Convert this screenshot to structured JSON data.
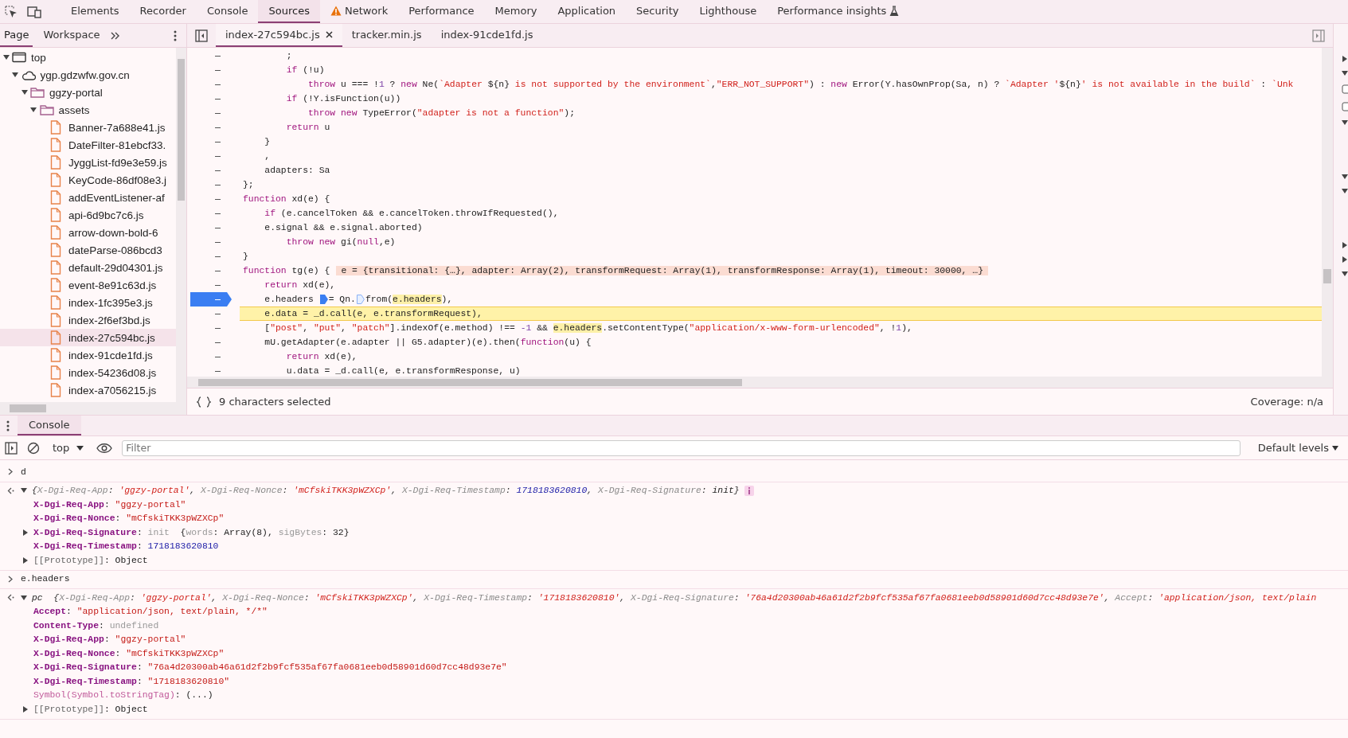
{
  "main_tabs": [
    {
      "label": "Elements",
      "selected": false,
      "kind": "plain"
    },
    {
      "label": "Recorder",
      "selected": false,
      "kind": "plain"
    },
    {
      "label": "Console",
      "selected": false,
      "kind": "plain"
    },
    {
      "label": "Sources",
      "selected": true,
      "kind": "plain"
    },
    {
      "label": "Network",
      "selected": false,
      "kind": "warning"
    },
    {
      "label": "Performance",
      "selected": false,
      "kind": "plain"
    },
    {
      "label": "Memory",
      "selected": false,
      "kind": "plain"
    },
    {
      "label": "Application",
      "selected": false,
      "kind": "plain"
    },
    {
      "label": "Security",
      "selected": false,
      "kind": "plain"
    },
    {
      "label": "Lighthouse",
      "selected": false,
      "kind": "plain"
    },
    {
      "label": "Performance insights",
      "selected": false,
      "kind": "experimental"
    }
  ],
  "navigator": {
    "tabs": [
      {
        "label": "Page",
        "selected": true
      },
      {
        "label": "Workspace",
        "selected": false
      }
    ],
    "tree": [
      {
        "label": "top",
        "kind": "frame",
        "expanded": true,
        "selected": false,
        "children": [
          {
            "label": "ygp.gdzwfw.gov.cn",
            "kind": "domain",
            "expanded": true,
            "selected": false,
            "children": [
              {
                "label": "ggzy-portal",
                "kind": "folder",
                "expanded": true,
                "selected": false,
                "children": [
                  {
                    "label": "assets",
                    "kind": "folder",
                    "expanded": true,
                    "selected": false,
                    "children": [
                      {
                        "label": "Banner-7a688e41.js",
                        "kind": "file",
                        "selected": false
                      },
                      {
                        "label": "DateFilter-81ebcf33.",
                        "kind": "file",
                        "selected": false
                      },
                      {
                        "label": "JyggList-fd9e3e59.js",
                        "kind": "file",
                        "selected": false
                      },
                      {
                        "label": "KeyCode-86df08e3.j",
                        "kind": "file",
                        "selected": false
                      },
                      {
                        "label": "addEventListener-af",
                        "kind": "file",
                        "selected": false
                      },
                      {
                        "label": "api-6d9bc7c6.js",
                        "kind": "file",
                        "selected": false
                      },
                      {
                        "label": "arrow-down-bold-6",
                        "kind": "file",
                        "selected": false
                      },
                      {
                        "label": "dateParse-086bcd3",
                        "kind": "file",
                        "selected": false
                      },
                      {
                        "label": "default-29d04301.js",
                        "kind": "file",
                        "selected": false
                      },
                      {
                        "label": "event-8e91c63d.js",
                        "kind": "file",
                        "selected": false
                      },
                      {
                        "label": "index-1fc395e3.js",
                        "kind": "file",
                        "selected": false
                      },
                      {
                        "label": "index-2f6ef3bd.js",
                        "kind": "file",
                        "selected": false
                      },
                      {
                        "label": "index-27c594bc.js",
                        "kind": "file",
                        "selected": true
                      },
                      {
                        "label": "index-91cde1fd.js",
                        "kind": "file",
                        "selected": false
                      },
                      {
                        "label": "index-54236d08.js",
                        "kind": "file",
                        "selected": false
                      },
                      {
                        "label": "index-a7056215.js",
                        "kind": "file",
                        "selected": false
                      }
                    ]
                  }
                ]
              }
            ]
          }
        ]
      }
    ]
  },
  "editor": {
    "tabs": [
      {
        "label": "index-27c594bc.js",
        "selected": true
      },
      {
        "label": "tracker.min.js",
        "selected": false
      },
      {
        "label": "index-91cde1fd.js",
        "selected": false
      }
    ],
    "lines": [
      {
        "breakpoint": false,
        "paused": false,
        "tokens": [
          {
            "kind": "plain",
            "text": "        ;"
          }
        ]
      },
      {
        "breakpoint": false,
        "paused": false,
        "tokens": [
          {
            "kind": "keyword",
            "text": "        if"
          },
          {
            "kind": "plain",
            "text": " (!u)"
          }
        ]
      },
      {
        "breakpoint": false,
        "paused": false,
        "tokens": [
          {
            "kind": "keyword",
            "text": "            throw"
          },
          {
            "kind": "plain",
            "text": " u === !"
          },
          {
            "kind": "number",
            "text": "1"
          },
          {
            "kind": "plain",
            "text": " ? "
          },
          {
            "kind": "keyword",
            "text": "new"
          },
          {
            "kind": "plain",
            "text": " Ne("
          },
          {
            "kind": "string",
            "text": "`Adapter "
          },
          {
            "kind": "plain",
            "text": "${n}"
          },
          {
            "kind": "string",
            "text": " is not supported by the environment`"
          },
          {
            "kind": "plain",
            "text": ","
          },
          {
            "kind": "string",
            "text": "\"ERR_NOT_SUPPORT\""
          },
          {
            "kind": "plain",
            "text": ") : "
          },
          {
            "kind": "keyword",
            "text": "new"
          },
          {
            "kind": "plain",
            "text": " Error(Y.hasOwnProp(Sa, n) ? "
          },
          {
            "kind": "string",
            "text": "`Adapter '"
          },
          {
            "kind": "plain",
            "text": "${n}"
          },
          {
            "kind": "string",
            "text": "' is not available in the build`"
          },
          {
            "kind": "plain",
            "text": " : "
          },
          {
            "kind": "string",
            "text": "`Unk"
          }
        ]
      },
      {
        "breakpoint": false,
        "paused": false,
        "tokens": [
          {
            "kind": "keyword",
            "text": "        if"
          },
          {
            "kind": "plain",
            "text": " (!Y.isFunction(u))"
          }
        ]
      },
      {
        "breakpoint": false,
        "paused": false,
        "tokens": [
          {
            "kind": "keyword",
            "text": "            throw new"
          },
          {
            "kind": "plain",
            "text": " TypeError("
          },
          {
            "kind": "string",
            "text": "\"adapter is not a function\""
          },
          {
            "kind": "plain",
            "text": ");"
          }
        ]
      },
      {
        "breakpoint": false,
        "paused": false,
        "tokens": [
          {
            "kind": "keyword",
            "text": "        return"
          },
          {
            "kind": "plain",
            "text": " u"
          }
        ]
      },
      {
        "breakpoint": false,
        "paused": false,
        "tokens": [
          {
            "kind": "plain",
            "text": "    }"
          }
        ]
      },
      {
        "breakpoint": false,
        "paused": false,
        "tokens": [
          {
            "kind": "plain",
            "text": "    ,"
          }
        ]
      },
      {
        "breakpoint": false,
        "paused": false,
        "tokens": [
          {
            "kind": "plain",
            "text": "    adapters: Sa"
          }
        ]
      },
      {
        "breakpoint": false,
        "paused": false,
        "tokens": [
          {
            "kind": "plain",
            "text": "};"
          }
        ]
      },
      {
        "breakpoint": false,
        "paused": false,
        "tokens": [
          {
            "kind": "keyword",
            "text": "function"
          },
          {
            "kind": "plain",
            "text": " xd(e) {"
          }
        ]
      },
      {
        "breakpoint": false,
        "paused": false,
        "tokens": [
          {
            "kind": "keyword",
            "text": "    if"
          },
          {
            "kind": "plain",
            "text": " (e.cancelToken && e.cancelToken.throwIfRequested(),"
          }
        ]
      },
      {
        "breakpoint": false,
        "paused": false,
        "tokens": [
          {
            "kind": "plain",
            "text": "    e.signal && e.signal.aborted)"
          }
        ]
      },
      {
        "breakpoint": false,
        "paused": false,
        "tokens": [
          {
            "kind": "keyword",
            "text": "        throw new"
          },
          {
            "kind": "plain",
            "text": " gi("
          },
          {
            "kind": "keyword",
            "text": "null"
          },
          {
            "kind": "plain",
            "text": ",e)"
          }
        ]
      },
      {
        "breakpoint": false,
        "paused": false,
        "tokens": [
          {
            "kind": "plain",
            "text": "}"
          }
        ]
      },
      {
        "breakpoint": false,
        "paused": false,
        "tokens": [
          {
            "kind": "keyword",
            "text": "function"
          },
          {
            "kind": "plain",
            "text": " tg(e) {"
          },
          {
            "kind": "inline_value",
            "text": "e = {transitional: {…}, adapter: Array(2), transformRequest: Array(1), transformResponse: Array(1), timeout: 30000, …}"
          }
        ]
      },
      {
        "breakpoint": false,
        "paused": false,
        "tokens": [
          {
            "kind": "keyword",
            "text": "    return"
          },
          {
            "kind": "plain",
            "text": " xd(e),"
          }
        ]
      },
      {
        "breakpoint": true,
        "paused": false,
        "tokens": [
          {
            "kind": "plain",
            "text": "    e.headers "
          },
          {
            "kind": "inline_breakpoint",
            "active": true
          },
          {
            "kind": "plain",
            "text": "= Qn."
          },
          {
            "kind": "inline_breakpoint",
            "active": false
          },
          {
            "kind": "plain",
            "text": "from("
          },
          {
            "kind": "match",
            "text": "e.headers"
          },
          {
            "kind": "plain",
            "text": "),"
          }
        ]
      },
      {
        "breakpoint": false,
        "paused": true,
        "tokens": [
          {
            "kind": "plain",
            "text": "    e.data "
          },
          {
            "kind": "match",
            "text": "="
          },
          {
            "kind": "plain",
            "text": " _d.call(e, e.transformRequest),"
          }
        ]
      },
      {
        "breakpoint": false,
        "paused": false,
        "tokens": [
          {
            "kind": "plain",
            "text": "    ["
          },
          {
            "kind": "string",
            "text": "\"post\""
          },
          {
            "kind": "plain",
            "text": ", "
          },
          {
            "kind": "string",
            "text": "\"put\""
          },
          {
            "kind": "plain",
            "text": ", "
          },
          {
            "kind": "string",
            "text": "\"patch\""
          },
          {
            "kind": "plain",
            "text": "].indexOf(e.method) !== "
          },
          {
            "kind": "number",
            "text": "-1"
          },
          {
            "kind": "plain",
            "text": " && "
          },
          {
            "kind": "match",
            "text": "e.headers"
          },
          {
            "kind": "plain",
            "text": ".setContentType("
          },
          {
            "kind": "string",
            "text": "\"application/x-www-form-urlencoded\""
          },
          {
            "kind": "plain",
            "text": ", !"
          },
          {
            "kind": "number",
            "text": "1"
          },
          {
            "kind": "plain",
            "text": "),"
          }
        ]
      },
      {
        "breakpoint": false,
        "paused": false,
        "tokens": [
          {
            "kind": "plain",
            "text": "    mU.getAdapter(e.adapter || G5.adapter)(e).then("
          },
          {
            "kind": "keyword",
            "text": "function"
          },
          {
            "kind": "plain",
            "text": "(u) {"
          }
        ]
      },
      {
        "breakpoint": false,
        "paused": false,
        "tokens": [
          {
            "kind": "keyword",
            "text": "        return"
          },
          {
            "kind": "plain",
            "text": " xd(e),"
          }
        ]
      },
      {
        "breakpoint": false,
        "paused": false,
        "tokens": [
          {
            "kind": "plain",
            "text": "        u.data = _d.call(e, e.transformResponse, u)"
          }
        ]
      }
    ],
    "status": {
      "selection": "9 characters selected",
      "coverage": "Coverage: n/a"
    }
  },
  "drawer": {
    "tabs": [
      {
        "label": "Console",
        "selected": true
      }
    ],
    "context": "top",
    "filter": {
      "placeholder": "Filter"
    },
    "levels": "Default levels",
    "entries": [
      {
        "kind": "input",
        "text": "d"
      },
      {
        "kind": "result",
        "expanded": true,
        "info_badge": true,
        "preview": [
          {
            "kind": "punct",
            "text": "{"
          },
          {
            "kind": "key",
            "text": "X-Dgi-Req-App"
          },
          {
            "kind": "punct",
            "text": ": "
          },
          {
            "kind": "string",
            "text": "'ggzy-portal'"
          },
          {
            "kind": "punct",
            "text": ", "
          },
          {
            "kind": "key",
            "text": "X-Dgi-Req-Nonce"
          },
          {
            "kind": "punct",
            "text": ": "
          },
          {
            "kind": "string",
            "text": "'mCfskiTKK3pWZXCp'"
          },
          {
            "kind": "punct",
            "text": ", "
          },
          {
            "kind": "key",
            "text": "X-Dgi-Req-Timestamp"
          },
          {
            "kind": "punct",
            "text": ": "
          },
          {
            "kind": "number",
            "text": "1718183620810"
          },
          {
            "kind": "punct",
            "text": ", "
          },
          {
            "kind": "key",
            "text": "X-Dgi-Req-Signature"
          },
          {
            "kind": "punct",
            "text": ": "
          },
          {
            "kind": "plain",
            "text": "init"
          },
          {
            "kind": "punct",
            "text": "}"
          }
        ],
        "properties": [
          {
            "key": "X-Dgi-Req-App",
            "kind": "own",
            "expandable": false,
            "value": [
              {
                "kind": "plain",
                "text": ": "
              },
              {
                "kind": "string",
                "text": "\"ggzy-portal\""
              }
            ]
          },
          {
            "key": "X-Dgi-Req-Nonce",
            "kind": "own",
            "expandable": false,
            "value": [
              {
                "kind": "plain",
                "text": ": "
              },
              {
                "kind": "string",
                "text": "\"mCfskiTKK3pWZXCp\""
              }
            ]
          },
          {
            "key": "X-Dgi-Req-Signature",
            "kind": "own",
            "expandable": true,
            "value": [
              {
                "kind": "plain",
                "text": ": "
              },
              {
                "kind": "muted",
                "text": "init"
              },
              {
                "kind": "plain",
                "text": "  {"
              },
              {
                "kind": "muted",
                "text": "words"
              },
              {
                "kind": "plain",
                "text": ": Array(8), "
              },
              {
                "kind": "muted",
                "text": "sigBytes"
              },
              {
                "kind": "plain",
                "text": ": 32}"
              }
            ]
          },
          {
            "key": "X-Dgi-Req-Timestamp",
            "kind": "own",
            "expandable": false,
            "value": [
              {
                "kind": "plain",
                "text": ": "
              },
              {
                "kind": "number",
                "text": "1718183620810"
              }
            ]
          },
          {
            "key": "[[Prototype]]",
            "kind": "internal",
            "expandable": true,
            "value": [
              {
                "kind": "plain",
                "text": ": Object"
              }
            ]
          }
        ]
      },
      {
        "kind": "input",
        "text": "e.headers"
      },
      {
        "kind": "result",
        "expanded": true,
        "info_badge": false,
        "preview": [
          {
            "kind": "class",
            "text": "pc"
          },
          {
            "kind": "punct",
            "text": "  {"
          },
          {
            "kind": "key",
            "text": "X-Dgi-Req-App"
          },
          {
            "kind": "punct",
            "text": ": "
          },
          {
            "kind": "string",
            "text": "'ggzy-portal'"
          },
          {
            "kind": "punct",
            "text": ", "
          },
          {
            "kind": "key",
            "text": "X-Dgi-Req-Nonce"
          },
          {
            "kind": "punct",
            "text": ": "
          },
          {
            "kind": "string",
            "text": "'mCfskiTKK3pWZXCp'"
          },
          {
            "kind": "punct",
            "text": ", "
          },
          {
            "kind": "key",
            "text": "X-Dgi-Req-Timestamp"
          },
          {
            "kind": "punct",
            "text": ": "
          },
          {
            "kind": "string",
            "text": "'1718183620810'"
          },
          {
            "kind": "punct",
            "text": ", "
          },
          {
            "kind": "key",
            "text": "X-Dgi-Req-Signature"
          },
          {
            "kind": "punct",
            "text": ": "
          },
          {
            "kind": "string",
            "text": "'76a4d20300ab46a61d2f2b9fcf535af67fa0681eeb0d58901d60d7cc48d93e7e'"
          },
          {
            "kind": "punct",
            "text": ", "
          },
          {
            "kind": "key",
            "text": "Accept"
          },
          {
            "kind": "punct",
            "text": ": "
          },
          {
            "kind": "string",
            "text": "'application/json, text/plain"
          }
        ],
        "properties": [
          {
            "key": "Accept",
            "kind": "own",
            "expandable": false,
            "value": [
              {
                "kind": "plain",
                "text": ": "
              },
              {
                "kind": "string",
                "text": "\"application/json, text/plain, */*\""
              }
            ]
          },
          {
            "key": "Content-Type",
            "kind": "own",
            "expandable": false,
            "value": [
              {
                "kind": "plain",
                "text": ": "
              },
              {
                "kind": "muted",
                "text": "undefined"
              }
            ]
          },
          {
            "key": "X-Dgi-Req-App",
            "kind": "own",
            "expandable": false,
            "value": [
              {
                "kind": "plain",
                "text": ": "
              },
              {
                "kind": "string",
                "text": "\"ggzy-portal\""
              }
            ]
          },
          {
            "key": "X-Dgi-Req-Nonce",
            "kind": "own",
            "expandable": false,
            "value": [
              {
                "kind": "plain",
                "text": ": "
              },
              {
                "kind": "string",
                "text": "\"mCfskiTKK3pWZXCp\""
              }
            ]
          },
          {
            "key": "X-Dgi-Req-Signature",
            "kind": "own",
            "expandable": false,
            "value": [
              {
                "kind": "plain",
                "text": ": "
              },
              {
                "kind": "string",
                "text": "\"76a4d20300ab46a61d2f2b9fcf535af67fa0681eeb0d58901d60d7cc48d93e7e\""
              }
            ]
          },
          {
            "key": "X-Dgi-Req-Timestamp",
            "kind": "own",
            "expandable": false,
            "value": [
              {
                "kind": "plain",
                "text": ": "
              },
              {
                "kind": "string",
                "text": "\"1718183620810\""
              }
            ]
          },
          {
            "key": "Symbol(Symbol.toStringTag)",
            "kind": "symbol",
            "expandable": false,
            "value": [
              {
                "kind": "plain",
                "text": ": (...)"
              }
            ]
          },
          {
            "key": "[[Prototype]]",
            "kind": "internal",
            "expandable": true,
            "value": [
              {
                "kind": "plain",
                "text": ": Object"
              }
            ]
          }
        ]
      }
    ]
  }
}
